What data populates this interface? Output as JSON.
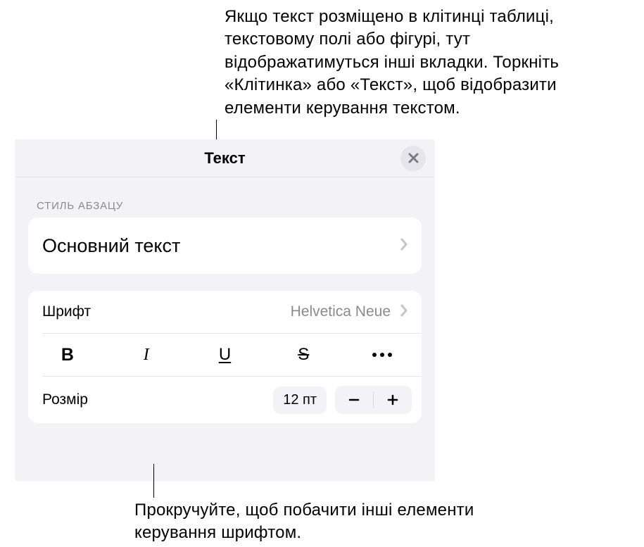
{
  "callout_top": "Якщо текст розміщено в клітинці таблиці, текстовому полі або фігурі, тут відображатимуться інші вкладки. Торкніть «Клітинка» або «Текст», щоб відобразити елементи керування текстом.",
  "callout_bottom": "Прокручуйте, щоб побачити інші елементи керування шрифтом.",
  "panel": {
    "title": "Текст",
    "section_label": "СТИЛЬ АБЗАЦУ",
    "paragraph_style": "Основний текст",
    "font_label": "Шрифт",
    "font_value": "Helvetica Neue",
    "styles": {
      "bold": "B",
      "italic": "I",
      "underline": "U",
      "strike": "S"
    },
    "size_label": "Розмір",
    "size_value": "12 пт"
  }
}
